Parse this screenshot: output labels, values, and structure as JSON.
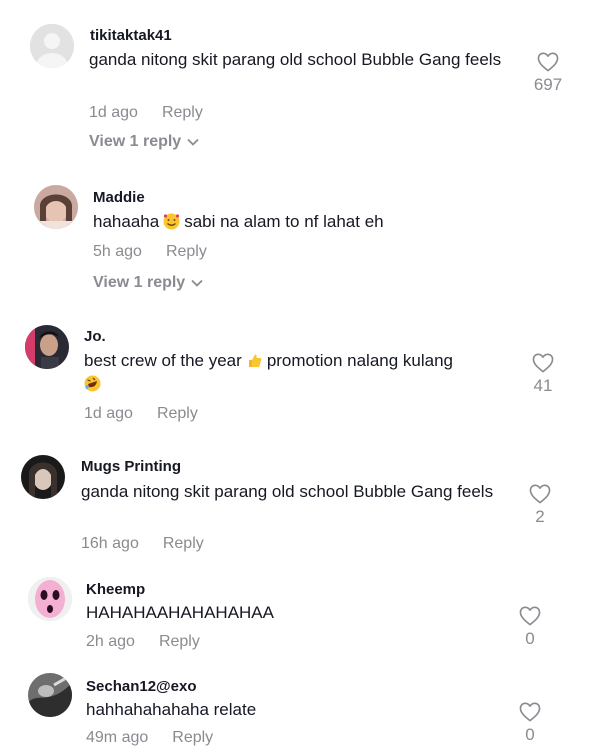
{
  "comments": [
    {
      "username": "tikitaktak41",
      "text": "ganda nitong skit parang old school Bubble Gang feels",
      "time": "1d ago",
      "reply_label": "Reply",
      "view_replies": "View 1 reply",
      "likes": "697",
      "avatar": "default-avatar"
    },
    {
      "username": "Maddie",
      "text_before": "hahaaha",
      "emoji": "smiling-face-with-hearts",
      "text_after": "sabi na alam to nf lahat eh",
      "time": "5h ago",
      "reply_label": "Reply",
      "view_replies": "View 1 reply",
      "avatar": "photo-avatar"
    },
    {
      "username": "Jo.",
      "text_before": "best crew of the year",
      "emoji": "thumbs-up",
      "text_after": "promotion nalang kulang",
      "emoji2": "rolling-on-floor-laughing",
      "time": "1d ago",
      "reply_label": "Reply",
      "likes": "41",
      "avatar": "photo-avatar"
    },
    {
      "username": "Mugs Printing",
      "text": "ganda nitong skit parang old school Bubble Gang feels",
      "time": "16h ago",
      "reply_label": "Reply",
      "likes": "2",
      "avatar": "photo-avatar"
    },
    {
      "username": "Kheemp",
      "text": "HAHAHAAHAHAHAHAA",
      "time": "2h ago",
      "reply_label": "Reply",
      "likes": "0",
      "avatar": "pink-face-avatar"
    },
    {
      "username": "Sechan12@exo",
      "text": "hahhahahahaha relate",
      "time": "49m ago",
      "reply_label": "Reply",
      "likes": "0",
      "avatar": "photo-avatar"
    }
  ],
  "colors": {
    "text": "#161823",
    "muted": "#8a8b91",
    "background": "#ffffff"
  },
  "icons": {
    "like": "heart-outline-icon",
    "expand": "chevron-down-icon"
  }
}
